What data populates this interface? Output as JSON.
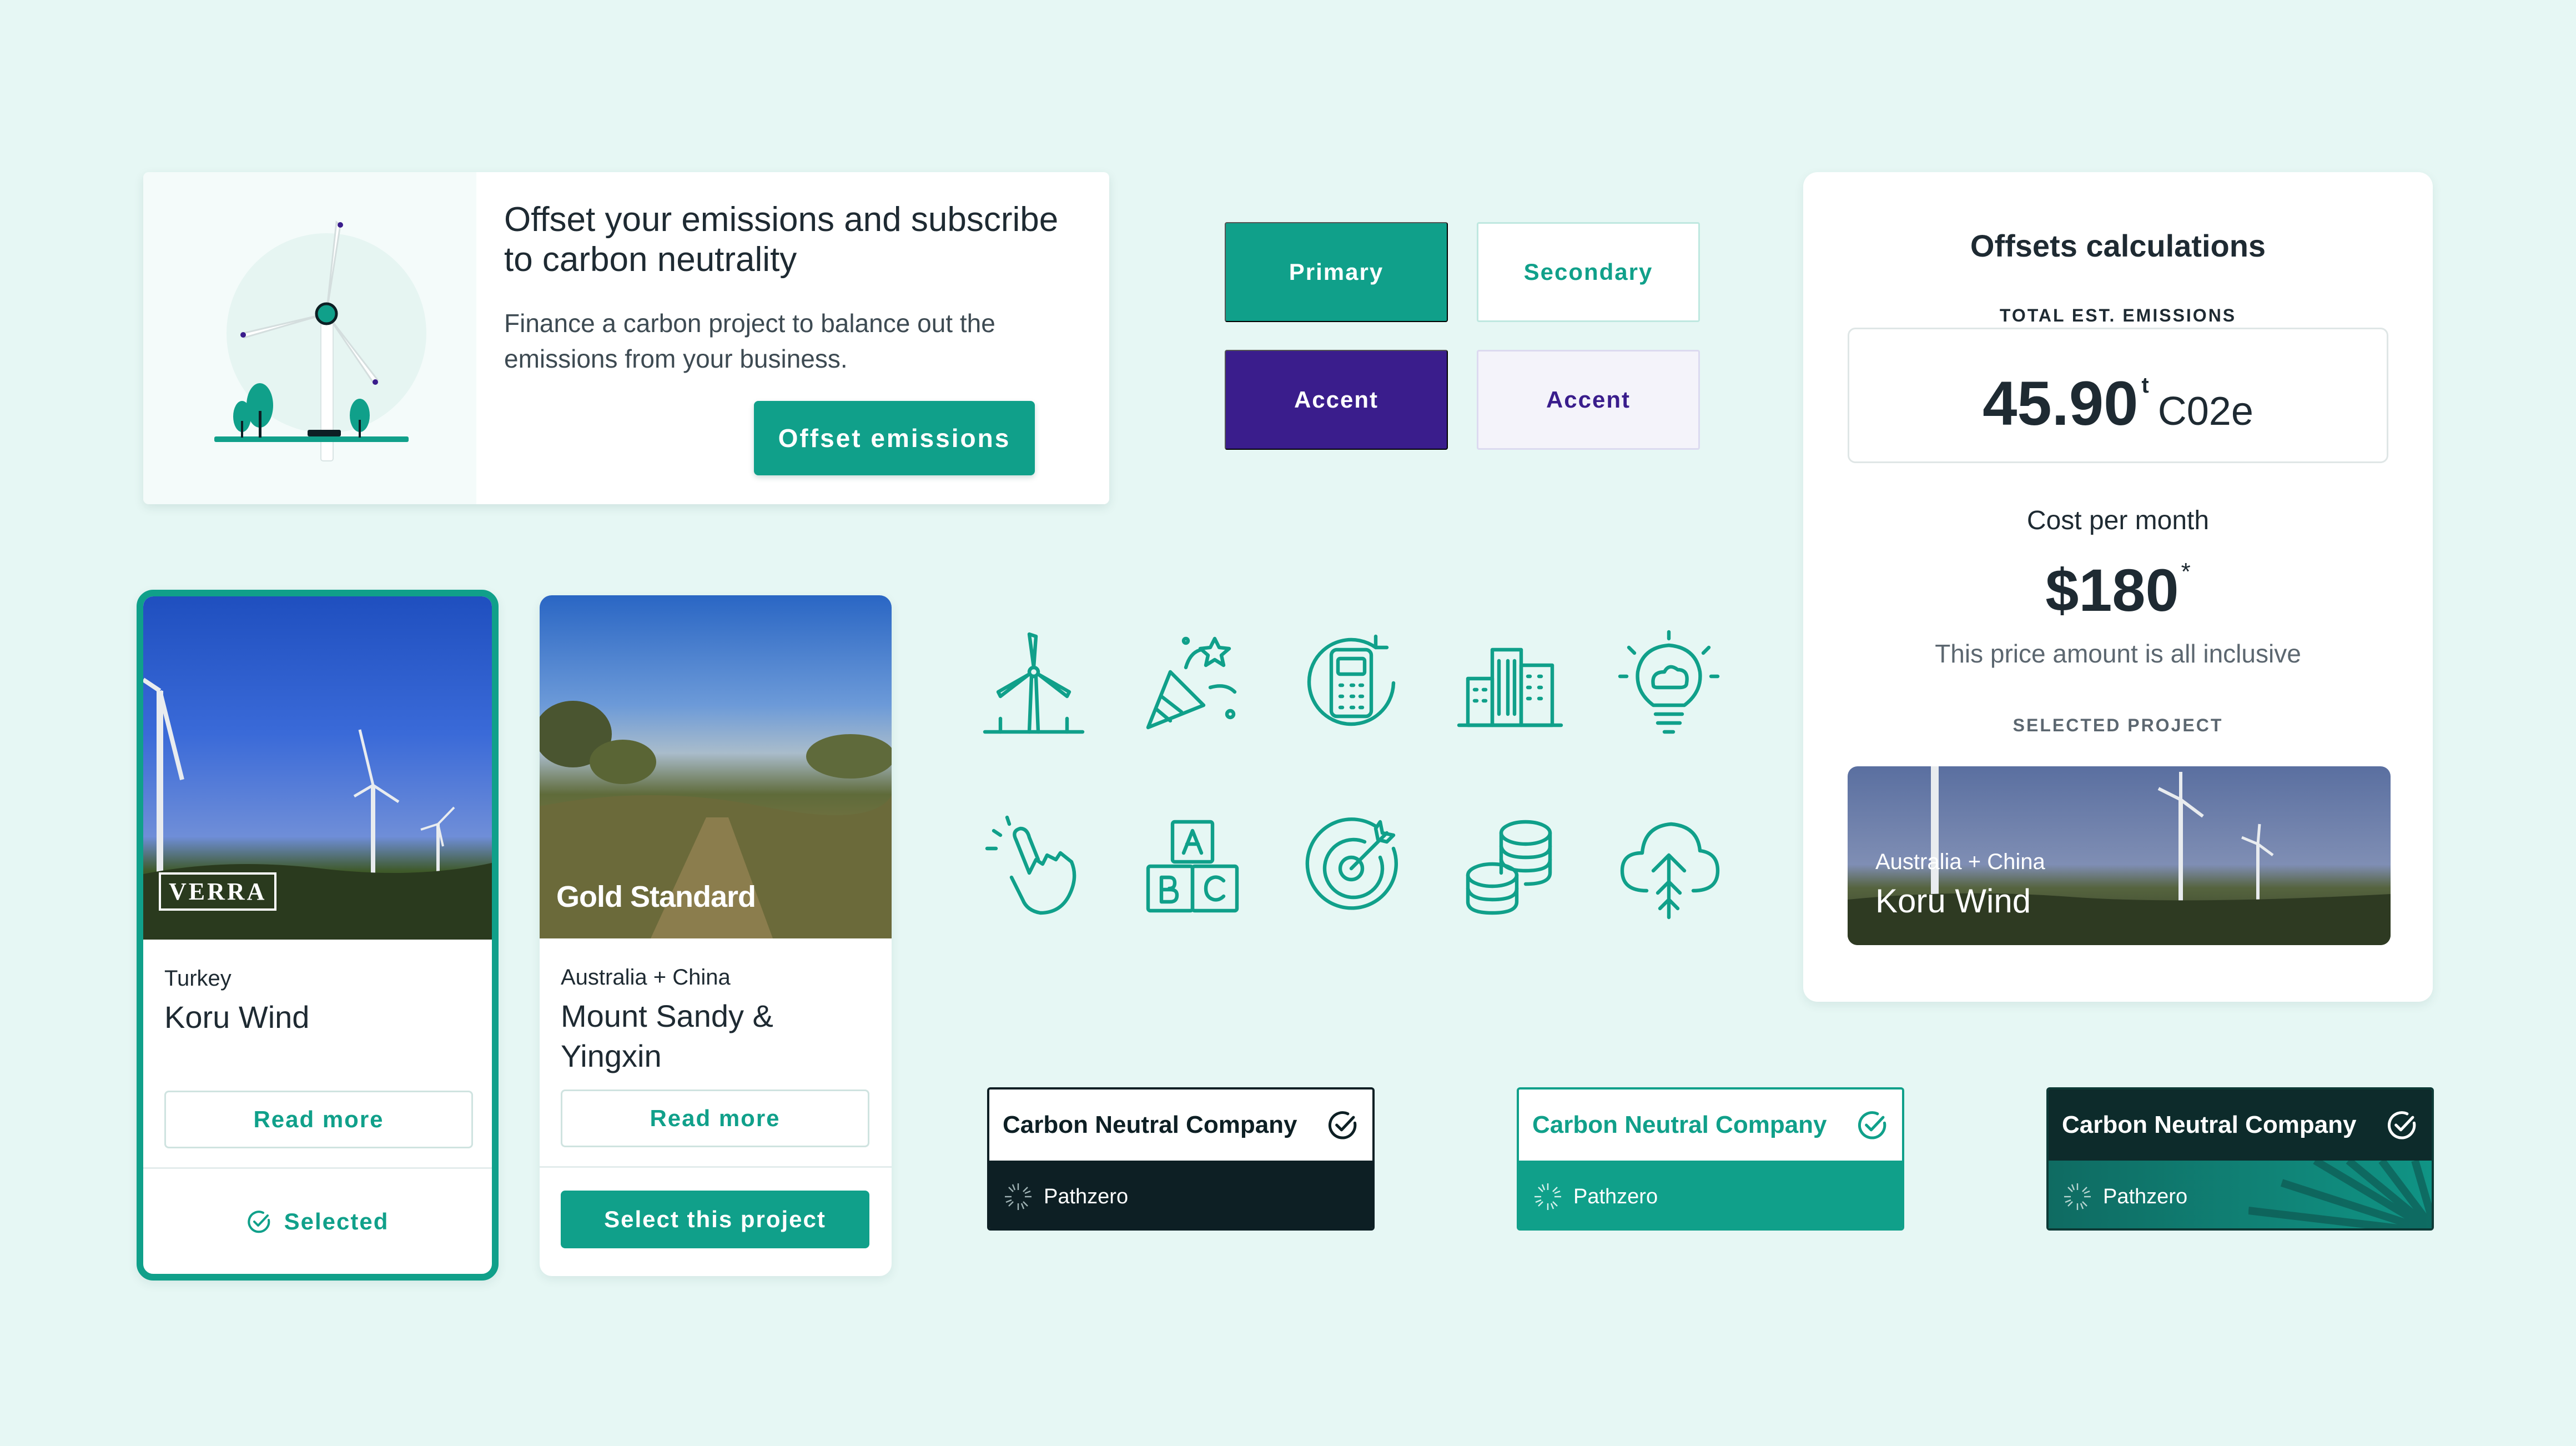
{
  "hero": {
    "title": "Offset your emissions and subscribe to carbon neutrality",
    "description": "Finance a carbon project to balance out the emissions from your business.",
    "cta_label": "Offset emissions"
  },
  "buttons": {
    "primary": "Primary",
    "secondary": "Secondary",
    "accent": "Accent",
    "accent_light": "Accent"
  },
  "calculations": {
    "title": "Offsets calculations",
    "total_label": "TOTAL EST. EMISSIONS",
    "total_value": "45.90",
    "total_sup": "t",
    "total_unit": "C02e",
    "cost_label": "Cost per month",
    "cost_value": "$180",
    "cost_sup": "*",
    "cost_note": "This price amount is all inclusive",
    "selected_label": "SELECTED PROJECT",
    "selected_project": {
      "location": "Australia + China",
      "name": "Koru Wind"
    }
  },
  "projects": [
    {
      "badge": "VERRA",
      "location": "Turkey",
      "name": "Koru Wind",
      "read_more": "Read more",
      "status": "Selected"
    },
    {
      "badge": "Gold Standard",
      "location": "Australia + China",
      "name": "Mount Sandy & Yingxin",
      "read_more": "Read more",
      "action": "Select this project"
    }
  ],
  "icons": [
    "wind-turbine-icon",
    "celebration-icon",
    "calculator-cycle-icon",
    "buildings-icon",
    "lightbulb-cloud-icon",
    "hand-tap-icon",
    "abc-blocks-icon",
    "target-icon",
    "coins-stack-icon",
    "cloud-upload-tree-icon"
  ],
  "badges": [
    {
      "title": "Carbon Neutral Company",
      "brand": "Pathzero"
    },
    {
      "title": "Carbon Neutral Company",
      "brand": "Pathzero"
    },
    {
      "title": "Carbon Neutral Company",
      "brand": "Pathzero"
    }
  ],
  "colors": {
    "background": "#e6f7f4",
    "primary": "#10a08a",
    "accent": "#3a1d8c",
    "dark": "#0d1f24"
  }
}
